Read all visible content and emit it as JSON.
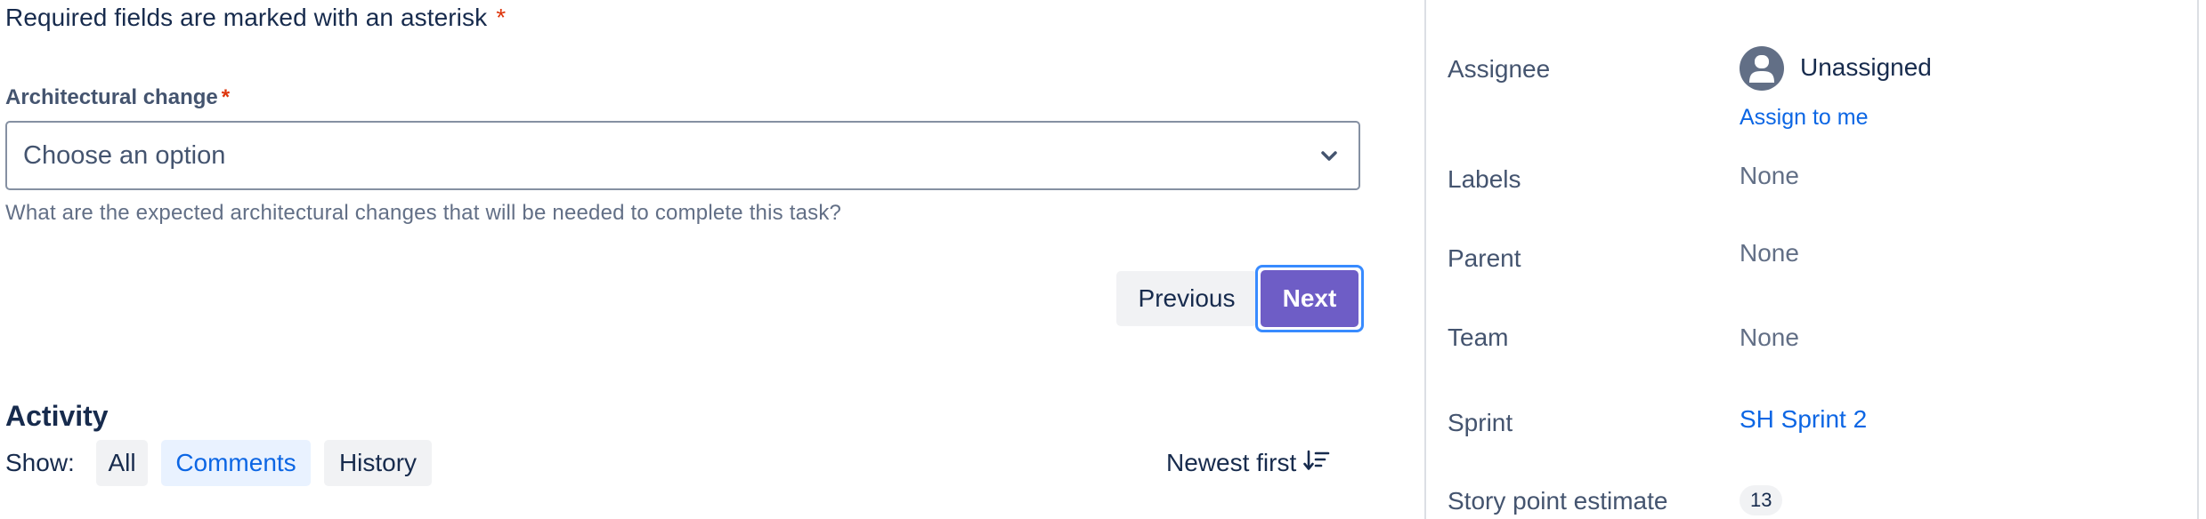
{
  "form": {
    "required_note": "Required fields are marked with an asterisk",
    "asterisk": "*",
    "field_label": "Architectural change",
    "select_placeholder": "Choose an option",
    "helper_text": "What are the expected architectural changes that will be needed to complete this task?",
    "previous_label": "Previous",
    "next_label": "Next"
  },
  "activity": {
    "heading": "Activity",
    "show_label": "Show:",
    "filters": [
      "All",
      "Comments",
      "History"
    ],
    "active_filter": "Comments",
    "sort_label": "Newest first",
    "sort_icon": "sort-descending-icon"
  },
  "details": {
    "assignee": {
      "label": "Assignee",
      "value": "Unassigned",
      "action": "Assign to me",
      "icon": "user-avatar-icon"
    },
    "labels": {
      "label": "Labels",
      "value": "None"
    },
    "parent": {
      "label": "Parent",
      "value": "None"
    },
    "team": {
      "label": "Team",
      "value": "None"
    },
    "sprint": {
      "label": "Sprint",
      "value": "SH Sprint 2"
    },
    "story_points": {
      "label": "Story point estimate",
      "value": "13"
    }
  },
  "colors": {
    "primary": "#6e5dc6",
    "focus_ring": "#388bff",
    "link": "#0c66e4",
    "required": "#de350b",
    "text": "#172b4d",
    "subtle_text": "#626f86"
  }
}
